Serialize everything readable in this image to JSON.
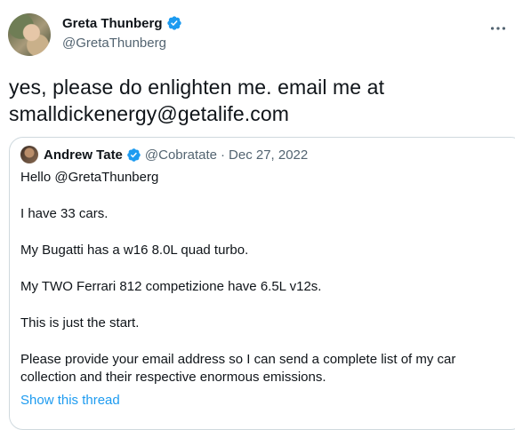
{
  "author": {
    "name": "Greta Thunberg",
    "handle": "@GretaThunberg",
    "verified": true
  },
  "tweet": {
    "text_line1": "yes, please do enlighten me. email me at",
    "text_line2": "smalldickenergy@getalife.com"
  },
  "quoted": {
    "name": "Andrew Tate",
    "handle": "@Cobratate",
    "separator": "·",
    "date": "Dec 27, 2022",
    "verified": true,
    "lines": [
      "Hello @GretaThunberg",
      "I have 33 cars.",
      "My Bugatti has a w16 8.0L quad turbo.",
      "My TWO Ferrari 812 competizione have 6.5L v12s.",
      "This is just the start.",
      "Please provide your email address so I can send a complete list of my car",
      "collection and their respective enormous emissions."
    ],
    "show_thread": "Show this thread"
  },
  "colors": {
    "verified_blue": "#1d9bf0",
    "secondary_text": "#536471",
    "border": "#cfd9de"
  },
  "icons": {
    "verified": "verified-badge-icon",
    "more": "more-options-icon"
  }
}
